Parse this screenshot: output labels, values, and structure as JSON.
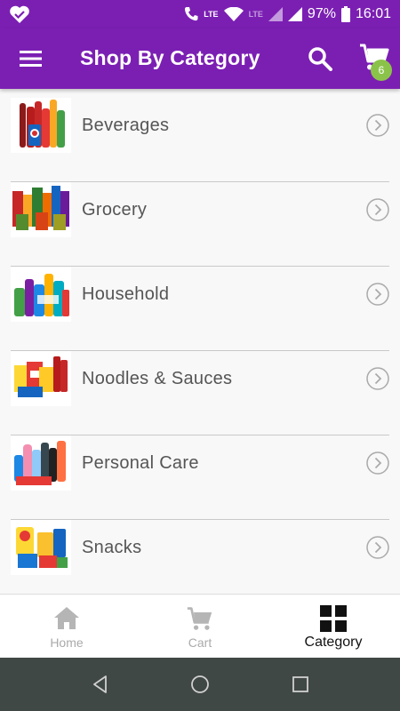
{
  "status": {
    "lte1": "LTE",
    "lte2": "LTE",
    "battery": "97%",
    "time": "16:01"
  },
  "appbar": {
    "title": "Shop By Category",
    "cart_count": "6"
  },
  "categories": [
    {
      "label": "Beverages",
      "thumb": "beverages"
    },
    {
      "label": "Grocery",
      "thumb": "grocery"
    },
    {
      "label": "Household",
      "thumb": "household"
    },
    {
      "label": "Noodles & Sauces",
      "thumb": "noodles"
    },
    {
      "label": "Personal Care",
      "thumb": "personal-care"
    },
    {
      "label": "Snacks",
      "thumb": "snacks"
    }
  ],
  "bottom_nav": [
    {
      "label": "Home",
      "icon": "home-icon",
      "active": false
    },
    {
      "label": "Cart",
      "icon": "cart-icon",
      "active": false
    },
    {
      "label": "Category",
      "icon": "grid-icon",
      "active": true
    }
  ],
  "colors": {
    "primary": "#7b1fb3",
    "badge": "#8bc34a",
    "sysnav": "#404846"
  }
}
